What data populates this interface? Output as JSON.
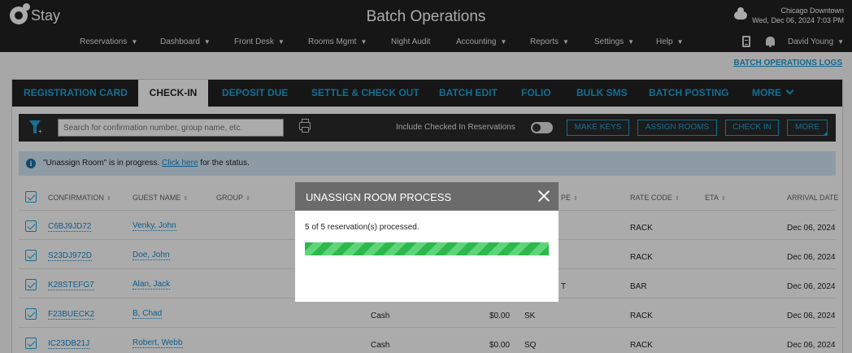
{
  "app": {
    "brand": "Stay",
    "title": "Batch Operations",
    "property": "Chicago Downtown",
    "datetime": "Wed, Dec 06, 2024 7:03 PM"
  },
  "nav": {
    "items": [
      {
        "label": "Reservations",
        "caret": "▼"
      },
      {
        "label": "Dashboard",
        "caret": "▼"
      },
      {
        "label": "Front Desk",
        "caret": "▼"
      },
      {
        "label": "Rooms Mgmt",
        "caret": "▼"
      },
      {
        "label": "Night Audit",
        "caret": ""
      },
      {
        "label": "Accounting",
        "caret": "▼"
      },
      {
        "label": "Reports",
        "caret": "▼"
      },
      {
        "label": "Settings",
        "caret": "▼"
      },
      {
        "label": "Help",
        "caret": "▼"
      }
    ],
    "user": "David Young",
    "user_caret": "▼"
  },
  "logs_link": "BATCH OPERATIONS LOGS",
  "tabs": [
    "REGISTRATION CARD",
    "CHECK-IN",
    "DEPOSIT DUE",
    "SETTLE & CHECK OUT",
    "BATCH EDIT",
    "FOLIO",
    "BULK SMS",
    "BATCH POSTING",
    "MORE"
  ],
  "toolbar": {
    "search_placeholder": "Search for confirmation number, group name, etc.",
    "toggle_label": "Include Checked In Reservations",
    "buttons": [
      "MAKE KEYS",
      "ASSIGN ROOMS",
      "CHECK IN",
      "MORE"
    ]
  },
  "info": {
    "prefix": "\"Unassign Room\" is in progress. ",
    "link": "Click here",
    "suffix": " for the status."
  },
  "table": {
    "columns": [
      "CONFIRMATION",
      "GUEST NAME",
      "GROUP",
      "PE",
      "RATE CODE",
      "ETA",
      "ARRIVAL DATE"
    ],
    "sort_glyph": "⇕",
    "rows": [
      {
        "confirmation": "C6BJ9JD72",
        "guest": "Venky, John",
        "payment": "",
        "amount": "",
        "type": "",
        "rate": "RACK",
        "arrival": "Dec 06, 2024"
      },
      {
        "confirmation": "S23DJ972D",
        "guest": "Doe, John",
        "payment": "",
        "amount": "",
        "type": "",
        "rate": "RACK",
        "arrival": "Dec 06, 2024"
      },
      {
        "confirmation": "K28STEFG7",
        "guest": "Alan, Jack",
        "payment": "",
        "amount": "",
        "type": "T",
        "rate": "BAR",
        "arrival": "Dec 06, 2024"
      },
      {
        "confirmation": "F23BUECK2",
        "guest": "B, Chad",
        "payment": "Cash",
        "amount": "$0.00",
        "type": "SK",
        "rate": "RACK",
        "arrival": "Dec 06, 2024"
      },
      {
        "confirmation": "IC23DB21J",
        "guest": "Robert, Webb",
        "payment": "Cash",
        "amount": "$0.00",
        "type": "SQ",
        "rate": "RACK",
        "arrival": "Dec 06, 2024"
      }
    ]
  },
  "modal": {
    "title": "UNASSIGN ROOM PROCESS",
    "message": "5 of 5 reservation(s) processed.",
    "progress_fraction": 1.0
  },
  "colors": {
    "accent": "#1ea5d8",
    "header_bg": "#222222",
    "progress_green": "#2db84d",
    "info_bg": "#d5e7f5"
  }
}
